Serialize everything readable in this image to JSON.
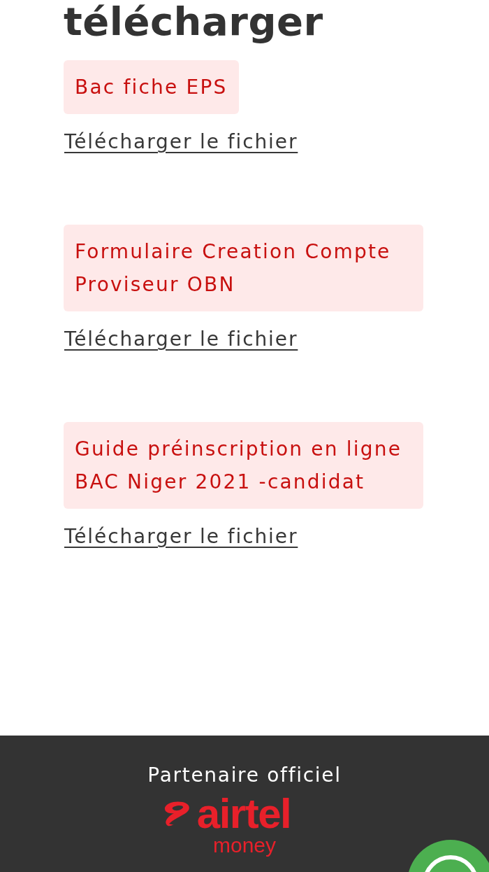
{
  "heading": "télécharger",
  "files": [
    {
      "title": "Bac fiche EPS",
      "link": "Télécharger le fichier"
    },
    {
      "title": "Formulaire Creation Compte Proviseur OBN",
      "link": "Télécharger le fichier"
    },
    {
      "title": "Guide préinscription en ligne BAC Niger 2021 -candidat",
      "link": "Télécharger le fichier"
    }
  ],
  "footer": {
    "caption": "Partenaire officiel",
    "partner_logo": {
      "wordmark": "airtel",
      "subtitle": "money"
    }
  }
}
